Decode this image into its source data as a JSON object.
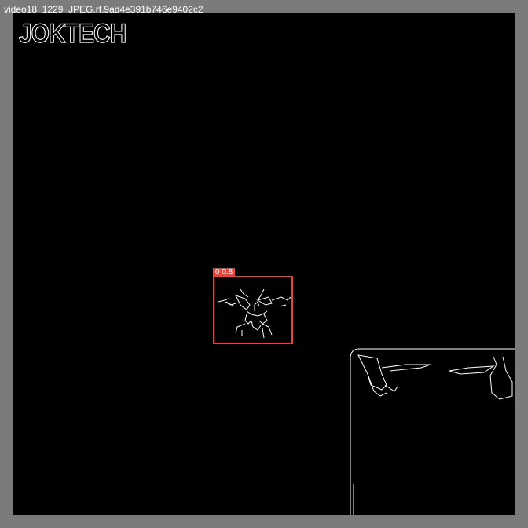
{
  "image_title": "video18_1229_JPEG.rf.9ad4e391b746e9402c2",
  "watermark": "JOKTECH",
  "detection": {
    "label": "0 0.8",
    "color": "#e8463c"
  }
}
